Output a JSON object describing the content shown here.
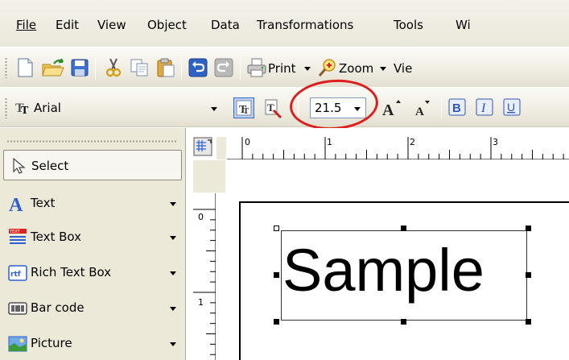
{
  "menu": {
    "file": "File",
    "edit": "Edit",
    "view": "View",
    "object": "Object",
    "data": "Data",
    "transformations": "Transformations",
    "tools": "Tools",
    "window_partial": "Wi"
  },
  "toolbar": {
    "print_label": "Print",
    "zoom_label": "Zoom",
    "view_partial": "Vie"
  },
  "format_toolbar": {
    "font_name": "Arial",
    "font_size": "21.5",
    "bold_letter": "B",
    "italic_letter": "I",
    "underline_letter": "U"
  },
  "tools_panel": {
    "select": "Select",
    "items": [
      {
        "label": "Text",
        "icon": "text-tool-icon"
      },
      {
        "label": "Text Box",
        "icon": "text-box-tool-icon"
      },
      {
        "label": "Rich Text Box",
        "icon": "rich-text-box-tool-icon"
      },
      {
        "label": "Bar code",
        "icon": "barcode-tool-icon"
      },
      {
        "label": "Picture",
        "icon": "picture-tool-icon"
      }
    ]
  },
  "ruler": {
    "top_numbers": [
      "0",
      "1",
      "2",
      "3"
    ],
    "left_numbers": [
      "0",
      "1"
    ]
  },
  "canvas": {
    "sample_text": "Sample"
  },
  "colors": {
    "highlight_ring": "#dd1e1e",
    "toolbar_bg": "#ece9d8",
    "accent_blue": "#316ac5"
  }
}
